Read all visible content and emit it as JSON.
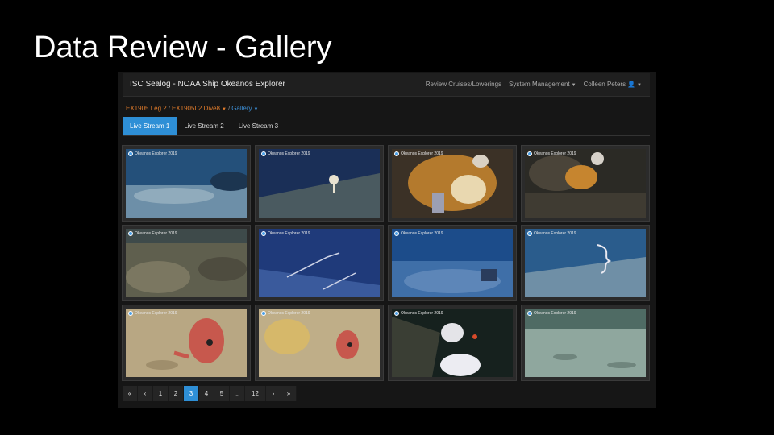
{
  "slide": {
    "title": "Data Review - Gallery"
  },
  "navbar": {
    "brand": "ISC Sealog - NOAA Ship Okeanos Explorer",
    "items": [
      {
        "label": "Review Cruises/Lowerings",
        "has_caret": false
      },
      {
        "label": "System Management",
        "has_caret": true
      },
      {
        "label": "Colleen Peters",
        "has_caret": true,
        "icon": "user-icon"
      }
    ]
  },
  "breadcrumb": {
    "cruise": "EX1905 Leg 2",
    "lowering": "EX1905L2 Dive8",
    "view": "Gallery",
    "separator": "/"
  },
  "tabs": [
    {
      "label": "Live Stream 1",
      "active": true
    },
    {
      "label": "Live Stream 2",
      "active": false
    },
    {
      "label": "Live Stream 3",
      "active": false
    }
  ],
  "gallery": {
    "watermark": "Okeanos Explorer 2019",
    "thumbnails": [
      {
        "scene": "blue seafloor rock"
      },
      {
        "scene": "white sponge on slope"
      },
      {
        "scene": "orange coral close-up"
      },
      {
        "scene": "orange coral on rock"
      },
      {
        "scene": "rocky seafloor"
      },
      {
        "scene": "white whip coral"
      },
      {
        "scene": "blue seafloor debris"
      },
      {
        "scene": "coiled whip coral"
      },
      {
        "scene": "red fish on sand"
      },
      {
        "scene": "red fish and sponge"
      },
      {
        "scene": "white sponges dark rock"
      },
      {
        "scene": "pale sandy seafloor"
      }
    ]
  },
  "pagination": {
    "first": "«",
    "prev": "‹",
    "pages": [
      "1",
      "2",
      "3",
      "4",
      "5"
    ],
    "active_page": "3",
    "ellipsis": "...",
    "last_page": "12",
    "next": "›",
    "last": "»"
  },
  "colors": {
    "accent": "#2e8fd6",
    "breadcrumb": "#e07b2b",
    "background": "#000000",
    "panel": "#161616"
  }
}
